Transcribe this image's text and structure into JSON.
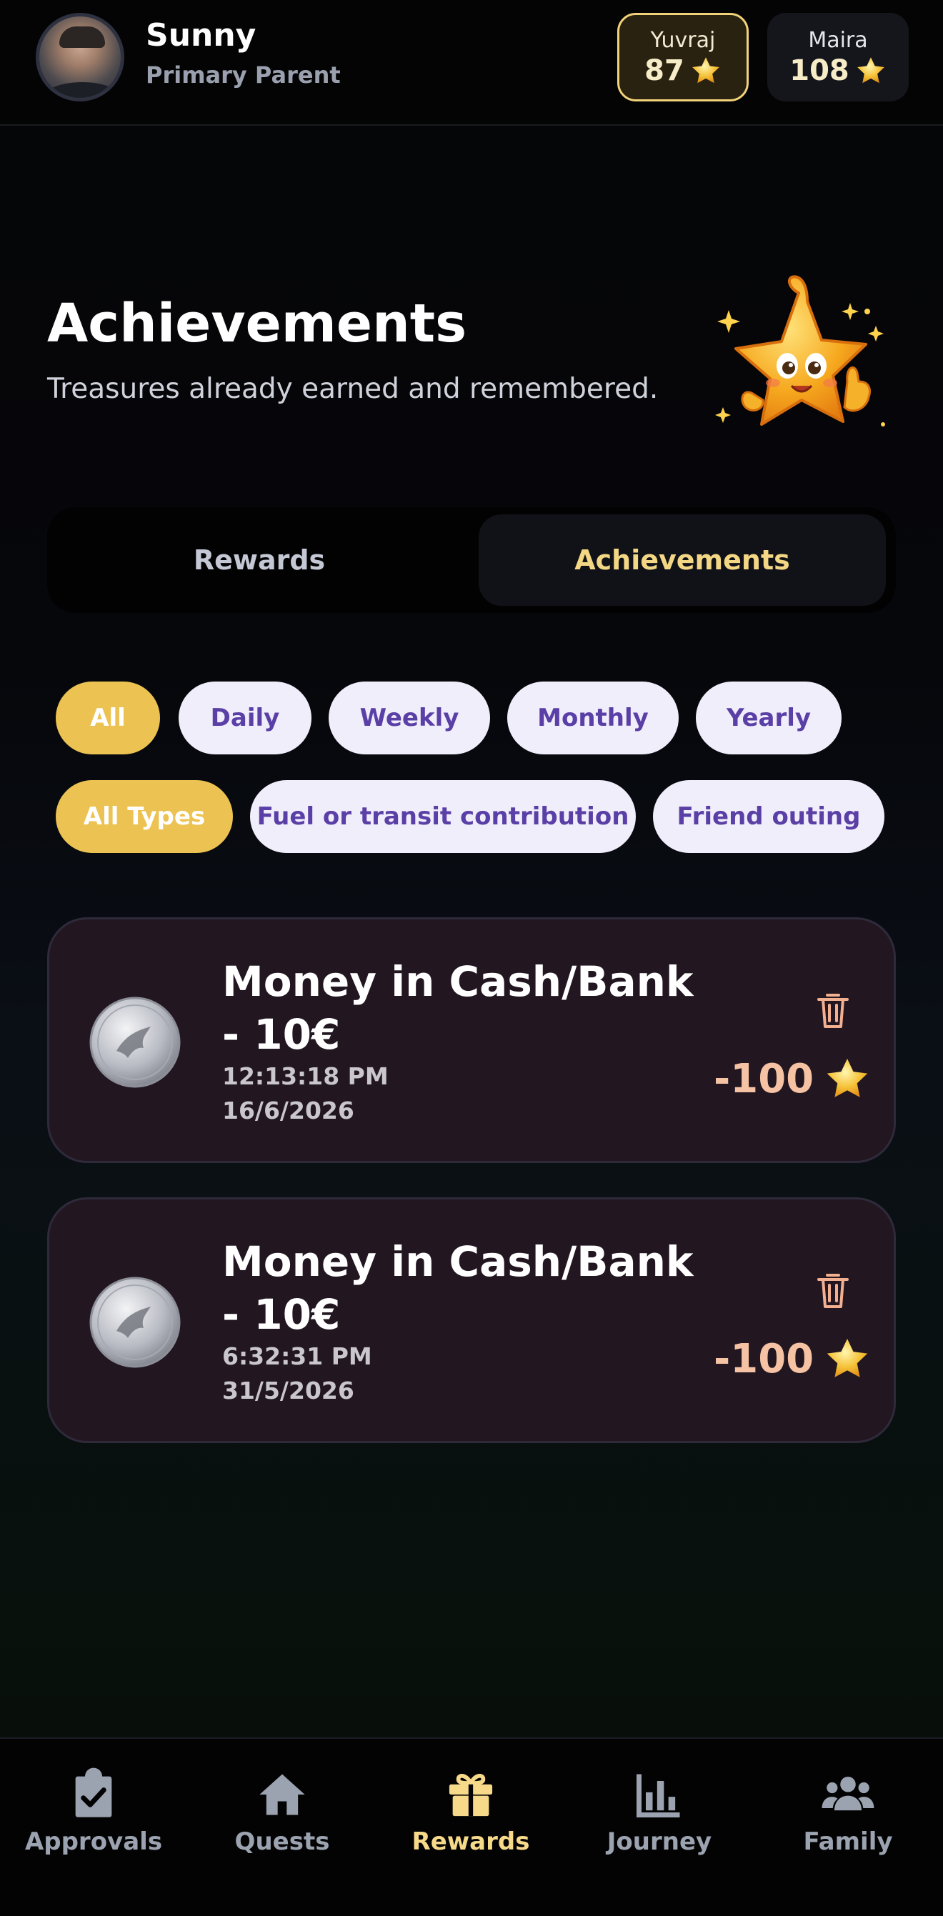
{
  "header": {
    "user_name": "Sunny",
    "user_role": "Primary Parent",
    "kids": [
      {
        "name": "Yuvraj",
        "points": "87",
        "active": true
      },
      {
        "name": "Maira",
        "points": "108",
        "active": false
      }
    ]
  },
  "page": {
    "title": "Achievements",
    "subtitle": "Treasures already earned and remembered."
  },
  "segment": {
    "rewards_label": "Rewards",
    "achievements_label": "Achievements",
    "selected": "Achievements"
  },
  "period_filters": [
    "All",
    "Daily",
    "Weekly",
    "Monthly",
    "Yearly"
  ],
  "period_selected": "All",
  "type_filters": [
    "All Types",
    "Fuel or transit contribution",
    "Friend outing"
  ],
  "type_selected": "All Types",
  "achievements": [
    {
      "title": "Money in Cash/Bank - 10€",
      "time": "12:13:18 PM",
      "date": "16/6/2026",
      "points": "-100"
    },
    {
      "title": "Money in Cash/Bank - 10€",
      "time": "6:32:31 PM",
      "date": "31/5/2026",
      "points": "-100"
    }
  ],
  "nav": {
    "approvals": "Approvals",
    "quests": "Quests",
    "rewards": "Rewards",
    "journey": "Journey",
    "family": "Family",
    "active": "Rewards"
  },
  "colors": {
    "accent_gold": "#ecc352",
    "chip_text": "#5a3fa6",
    "card_bg": "#221621",
    "points": "#f5c3a4"
  },
  "icons": [
    "star-icon",
    "trash-icon",
    "coin-icon",
    "clipboard-check-icon",
    "home-icon",
    "gift-icon",
    "bar-chart-icon",
    "users-icon"
  ]
}
